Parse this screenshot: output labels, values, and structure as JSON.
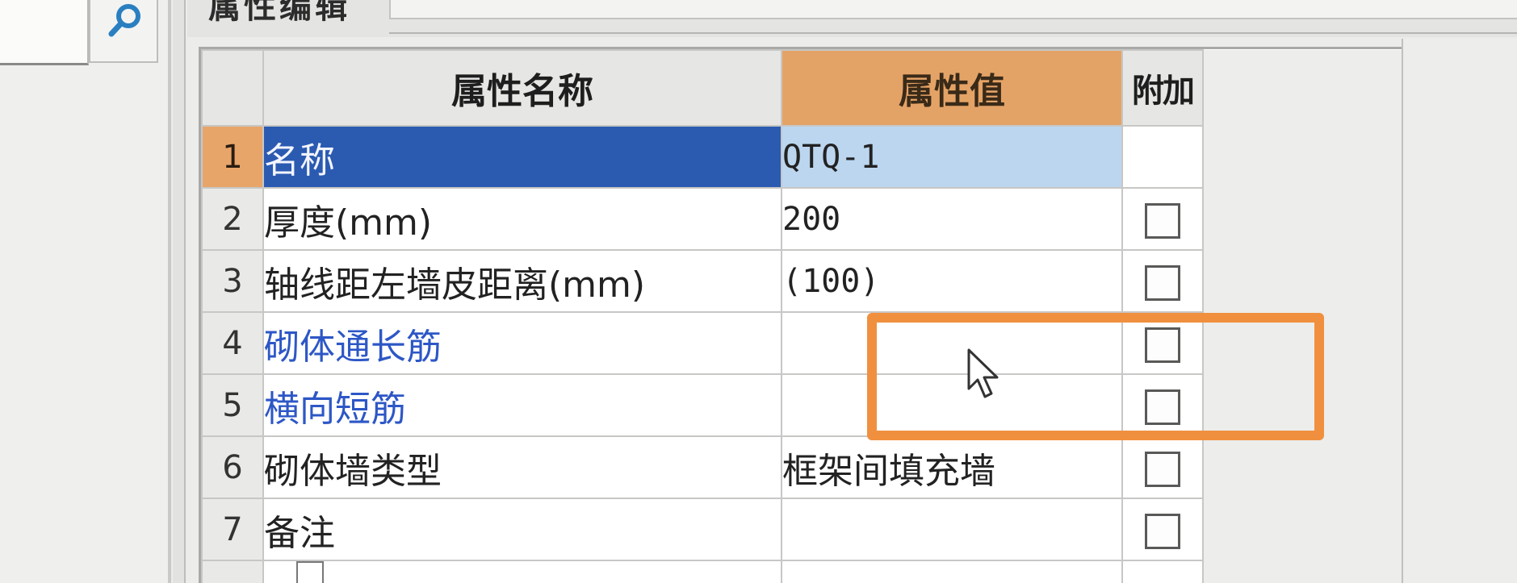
{
  "panel": {
    "title": "属性编辑"
  },
  "table": {
    "headers": {
      "name": "属性名称",
      "value": "属性值",
      "extra": "附加"
    },
    "rows": [
      {
        "index": "1",
        "name": "名称",
        "value": "QTQ-1",
        "name_style": "selected",
        "has_checkbox": false,
        "checked": false
      },
      {
        "index": "2",
        "name": "厚度(mm)",
        "value": "200",
        "name_style": "normal",
        "has_checkbox": true,
        "checked": false
      },
      {
        "index": "3",
        "name": "轴线距左墙皮距离(mm)",
        "value": "(100)",
        "name_style": "normal",
        "has_checkbox": true,
        "checked": false
      },
      {
        "index": "4",
        "name": "砌体通长筋",
        "value": "",
        "name_style": "blue",
        "has_checkbox": true,
        "checked": false
      },
      {
        "index": "5",
        "name": "横向短筋",
        "value": "",
        "name_style": "blue",
        "has_checkbox": true,
        "checked": false
      },
      {
        "index": "6",
        "name": "砌体墙类型",
        "value": "框架间填充墙",
        "name_style": "normal",
        "has_checkbox": true,
        "checked": false
      },
      {
        "index": "7",
        "name": "备注",
        "value": "",
        "name_style": "normal",
        "has_checkbox": true,
        "checked": false
      }
    ]
  },
  "colors": {
    "selected_row": "#2b5bb1",
    "header_value": "#e4a366",
    "highlight_box": "#f0903f",
    "blue_text": "#2d57c6"
  },
  "icons": {
    "search": "search-icon",
    "cursor": "mouse-pointer-icon"
  }
}
